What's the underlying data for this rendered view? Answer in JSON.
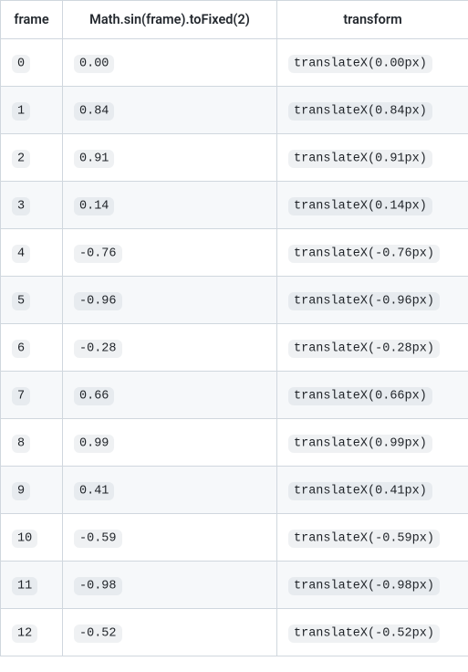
{
  "table": {
    "headers": [
      "frame",
      "Math.sin(frame).toFixed(2)",
      "transform"
    ],
    "rows": [
      {
        "frame": "0",
        "sin": "0.00",
        "transform": "translateX(0.00px)"
      },
      {
        "frame": "1",
        "sin": "0.84",
        "transform": "translateX(0.84px)"
      },
      {
        "frame": "2",
        "sin": "0.91",
        "transform": "translateX(0.91px)"
      },
      {
        "frame": "3",
        "sin": "0.14",
        "transform": "translateX(0.14px)"
      },
      {
        "frame": "4",
        "sin": "-0.76",
        "transform": "translateX(-0.76px)"
      },
      {
        "frame": "5",
        "sin": "-0.96",
        "transform": "translateX(-0.96px)"
      },
      {
        "frame": "6",
        "sin": "-0.28",
        "transform": "translateX(-0.28px)"
      },
      {
        "frame": "7",
        "sin": "0.66",
        "transform": "translateX(0.66px)"
      },
      {
        "frame": "8",
        "sin": "0.99",
        "transform": "translateX(0.99px)"
      },
      {
        "frame": "9",
        "sin": "0.41",
        "transform": "translateX(0.41px)"
      },
      {
        "frame": "10",
        "sin": "-0.59",
        "transform": "translateX(-0.59px)"
      },
      {
        "frame": "11",
        "sin": "-0.98",
        "transform": "translateX(-0.98px)"
      },
      {
        "frame": "12",
        "sin": "-0.52",
        "transform": "translateX(-0.52px)"
      }
    ]
  }
}
